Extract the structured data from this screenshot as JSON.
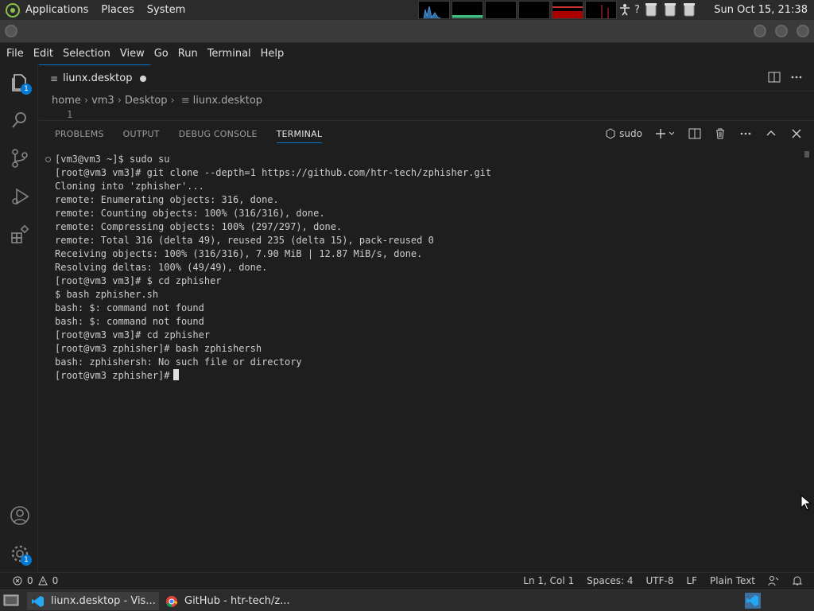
{
  "top_panel": {
    "menus": [
      "Applications",
      "Places",
      "System"
    ],
    "clock": "Sun Oct 15, 21:38",
    "tray_help": "?"
  },
  "menubar": [
    "File",
    "Edit",
    "Selection",
    "View",
    "Go",
    "Run",
    "Terminal",
    "Help"
  ],
  "activity": {
    "explorer_badge": "1",
    "settings_badge": "1"
  },
  "tabs": {
    "active_label": "liunx.desktop"
  },
  "breadcrumb": [
    "home",
    "vm3",
    "Desktop",
    "liunx.desktop"
  ],
  "editor": {
    "line_number": "1"
  },
  "panel": {
    "tabs": [
      "PROBLEMS",
      "OUTPUT",
      "DEBUG CONSOLE",
      "TERMINAL"
    ],
    "active_tab": "TERMINAL",
    "shell_label": "sudo",
    "terminal_lines": [
      "[vm3@vm3 ~]$ sudo su",
      "[root@vm3 vm3]# git clone --depth=1 https://github.com/htr-tech/zphisher.git",
      "Cloning into 'zphisher'...",
      "remote: Enumerating objects: 316, done.",
      "remote: Counting objects: 100% (316/316), done.",
      "remote: Compressing objects: 100% (297/297), done.",
      "remote: Total 316 (delta 49), reused 235 (delta 15), pack-reused 0",
      "Receiving objects: 100% (316/316), 7.90 MiB | 12.87 MiB/s, done.",
      "Resolving deltas: 100% (49/49), done.",
      "[root@vm3 vm3]# $ cd zphisher",
      "$ bash zphisher.sh",
      "bash: $: command not found",
      "bash: $: command not found",
      "[root@vm3 vm3]# cd zphisher",
      "[root@vm3 zphisher]# bash zphishersh",
      "bash: zphishersh: No such file or directory"
    ],
    "prompt": "[root@vm3 zphisher]#"
  },
  "statusbar": {
    "errors": "0",
    "warnings": "0",
    "position": "Ln 1, Col 1",
    "spaces": "Spaces: 4",
    "encoding": "UTF-8",
    "eol": "LF",
    "language": "Plain Text"
  },
  "taskbar": {
    "vscode_label": "liunx.desktop - Vis...",
    "chrome_label": "GitHub - htr-tech/z..."
  },
  "colors": {
    "accent": "#0078d4",
    "panel_bg": "#2b2b2b",
    "editor_bg": "#1e1e1e"
  }
}
